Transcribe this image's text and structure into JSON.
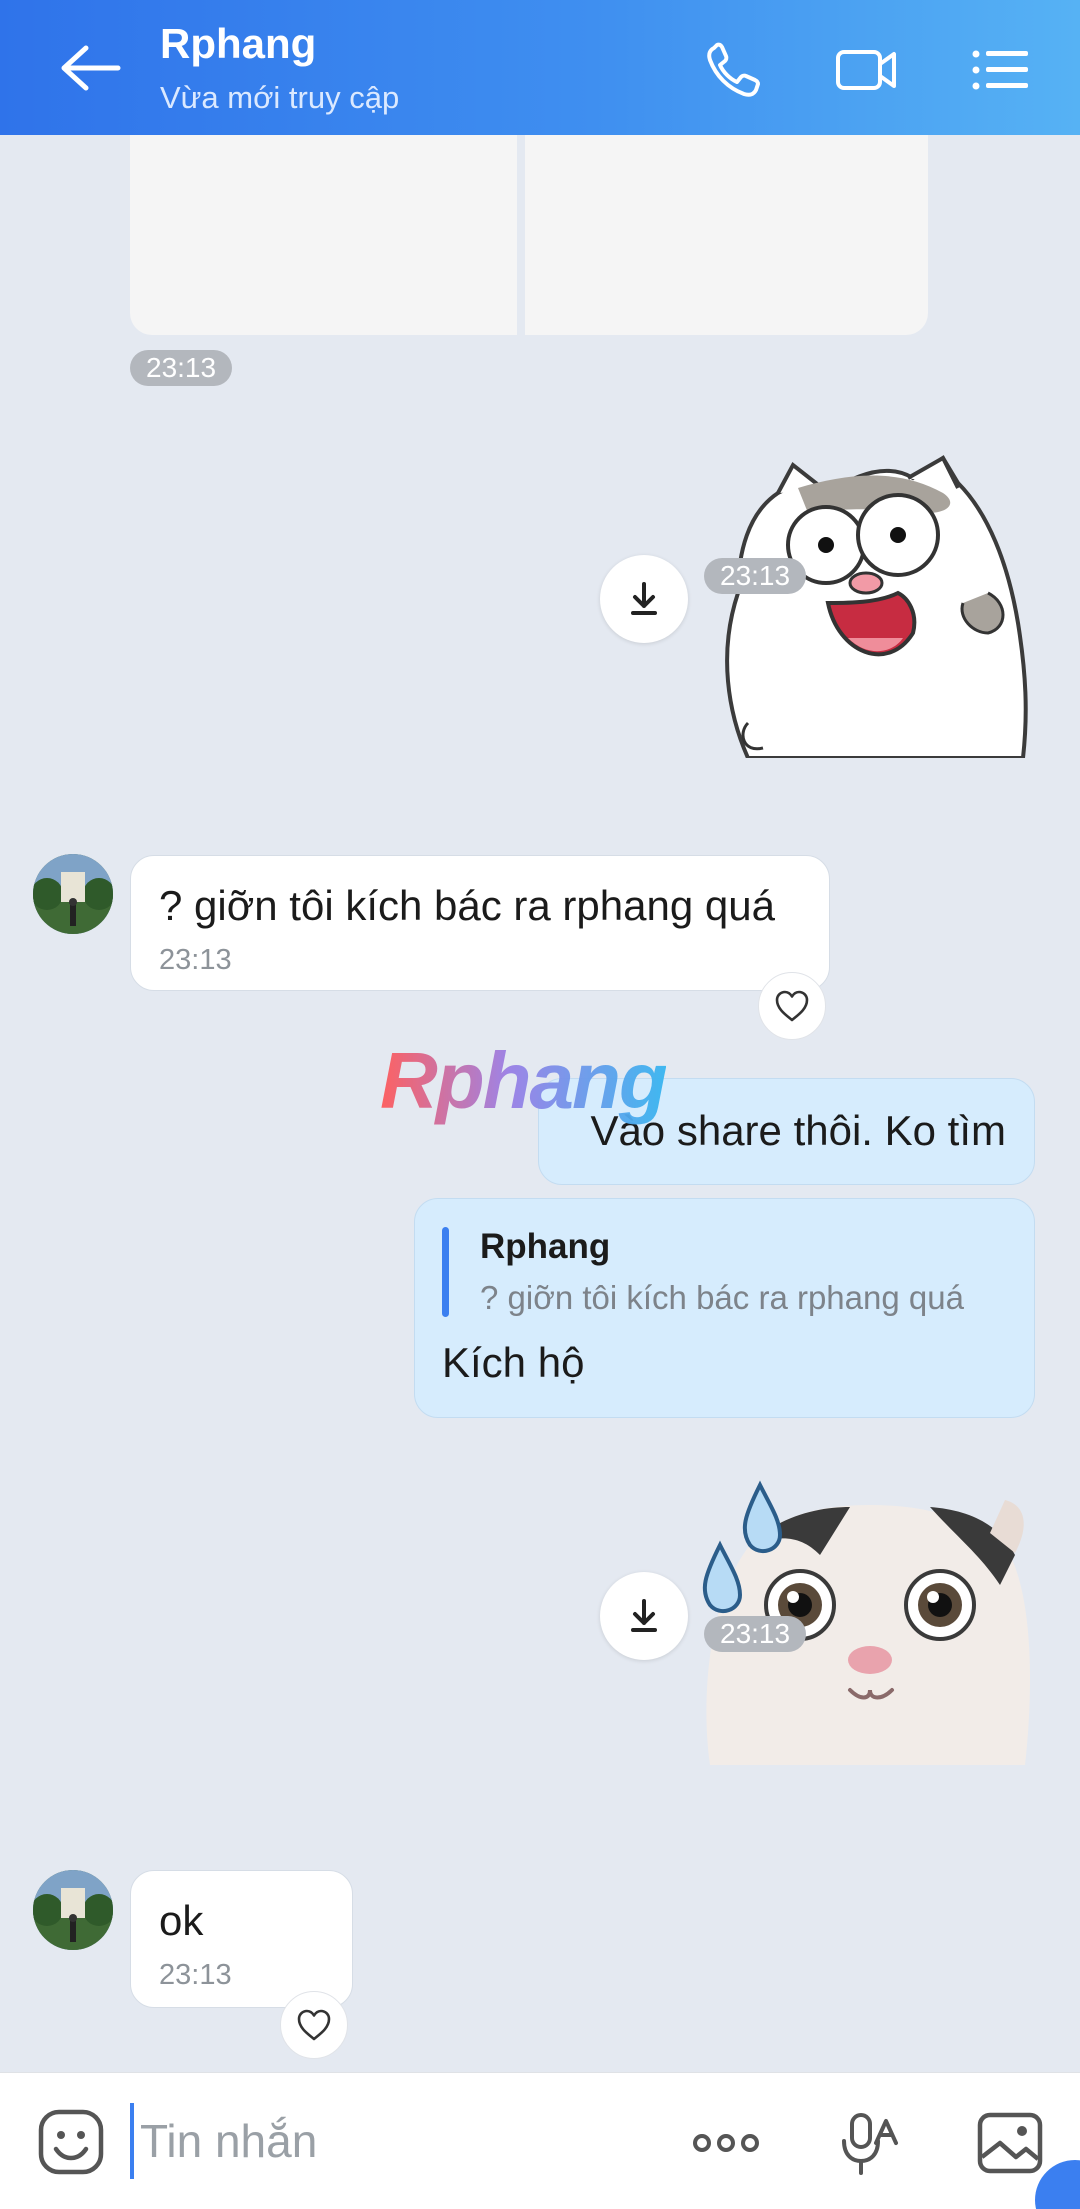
{
  "header": {
    "title": "Rphang",
    "subtitle": "Vừa mới truy cập",
    "icons": [
      "back-arrow-icon",
      "phone-icon",
      "video-camera-icon",
      "menu-list-icon"
    ]
  },
  "messages": {
    "photo_time": "23:13",
    "sticker1_time": "23:13",
    "msg1": {
      "text": "? giỡn tôi kích bác ra rphang quá",
      "time": "23:13"
    },
    "msg2": {
      "text": "Vào share thôi. Ko tìm"
    },
    "reply": {
      "quoted_name": "Rphang",
      "quoted_text": "? giỡn tôi kích bác ra rphang quá",
      "text": "Kích hộ"
    },
    "sticker2_time": "23:13",
    "msg3": {
      "text": "ok",
      "time": "23:13"
    }
  },
  "watermark": "Rphang",
  "composer": {
    "placeholder": "Tin nhắn",
    "icons": [
      "emoji-icon",
      "more-icon",
      "microphone-icon",
      "image-icon"
    ]
  },
  "colors": {
    "header_gradient_start": "#2f73ea",
    "header_gradient_end": "#56b2f4",
    "chat_background": "#e4e9f1",
    "outgoing_bubble": "#d6ecfd",
    "incoming_bubble": "#ffffff",
    "accent": "#3b7ff0"
  }
}
